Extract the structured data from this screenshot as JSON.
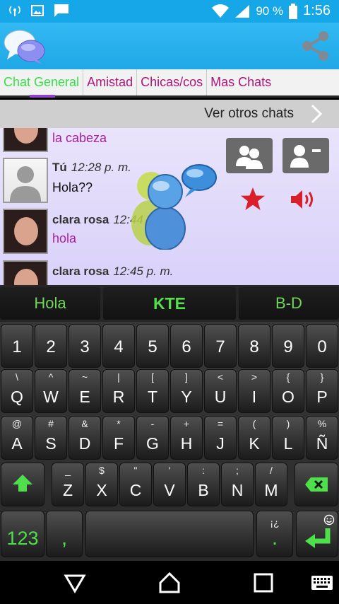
{
  "status_bar": {
    "battery": "90 %",
    "time": "1:56",
    "icons": [
      "wireless-hotspot-icon",
      "image-notification-icon",
      "message-notification-icon",
      "wifi-icon",
      "signal-icon",
      "battery-icon"
    ]
  },
  "app_bar": {
    "logo_icon": "chat-bubbles-logo",
    "share_icon": "share-icon"
  },
  "tabs": [
    {
      "label": "Chat General",
      "active": true
    },
    {
      "label": "Amistad",
      "active": false
    },
    {
      "label": "Chicas/cos",
      "active": false
    },
    {
      "label": "Mas Chats",
      "active": false
    }
  ],
  "other_chats": {
    "label": "Ver otros chats"
  },
  "chat": {
    "messages": [
      {
        "name": "",
        "time": "",
        "text": "la cabeza",
        "avatar": "photo"
      },
      {
        "name": "Tú",
        "time": "12:28 p. m.",
        "text": "Hola??",
        "avatar": "blank"
      },
      {
        "name": "clara rosa",
        "time": "12:44 p. m.",
        "text": "hola",
        "avatar": "photo"
      },
      {
        "name": "clara rosa",
        "time": "12:45 p. m.",
        "text": "",
        "avatar": "photo"
      }
    ],
    "controls": {
      "group_icon": "users-group-icon",
      "remove_user_icon": "remove-user-icon",
      "favorite_icon": "star-icon",
      "sound_icon": "volume-icon"
    },
    "colors": {
      "accent_pink": "#a61fa3",
      "star_red": "#d9202a"
    }
  },
  "keyboard": {
    "suggestions": [
      "Hola",
      "KTE",
      "B-D"
    ],
    "number_row": [
      "1",
      "2",
      "3",
      "4",
      "5",
      "6",
      "7",
      "8",
      "9",
      "0"
    ],
    "row1": [
      {
        "main": "Q",
        "sub": "\\"
      },
      {
        "main": "W",
        "sub": "^"
      },
      {
        "main": "E",
        "sub": "~"
      },
      {
        "main": "R",
        "sub": "|"
      },
      {
        "main": "T",
        "sub": "["
      },
      {
        "main": "Y",
        "sub": "]"
      },
      {
        "main": "U",
        "sub": "<"
      },
      {
        "main": "I",
        "sub": ">"
      },
      {
        "main": "O",
        "sub": "{"
      },
      {
        "main": "P",
        "sub": "}"
      }
    ],
    "row2": [
      {
        "main": "A",
        "sub": "@"
      },
      {
        "main": "S",
        "sub": "#"
      },
      {
        "main": "D",
        "sub": "&"
      },
      {
        "main": "F",
        "sub": "*"
      },
      {
        "main": "G",
        "sub": "-"
      },
      {
        "main": "H",
        "sub": "+"
      },
      {
        "main": "J",
        "sub": "="
      },
      {
        "main": "K",
        "sub": "("
      },
      {
        "main": "L",
        "sub": ")"
      },
      {
        "main": "Ñ",
        "sub": "%"
      }
    ],
    "row3": [
      {
        "main": "Z",
        "sub": "_"
      },
      {
        "main": "X",
        "sub": "$"
      },
      {
        "main": "C",
        "sub": "\""
      },
      {
        "main": "V",
        "sub": "'"
      },
      {
        "main": "B",
        "sub": ":"
      },
      {
        "main": "N",
        "sub": ";"
      },
      {
        "main": "M",
        "sub": "/"
      }
    ],
    "bottom": {
      "numbers": "123",
      "comma": ",",
      "period": ".",
      "period_sub": "¡¿"
    },
    "icons": {
      "shift": "shift-arrow-icon",
      "backspace": "backspace-icon",
      "enter": "enter-icon",
      "emoji": "emoji-icon"
    }
  },
  "nav_bar": {
    "icons": [
      "back-icon",
      "home-icon",
      "recents-icon",
      "keyboard-icon"
    ]
  }
}
